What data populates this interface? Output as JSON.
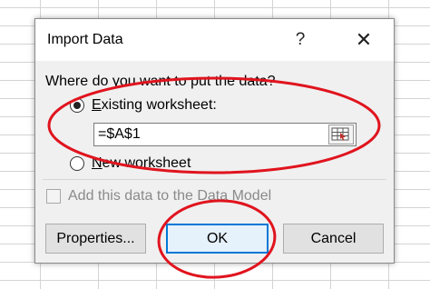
{
  "dialog": {
    "title": "Import Data",
    "help_glyph": "?",
    "close_glyph": "✕",
    "prompt": "Where do you want to put the data?",
    "existing_label": "Existing worksheet:",
    "existing_label_parts": {
      "accel": "E",
      "rest": "xisting worksheet:"
    },
    "new_label_parts": {
      "accel": "N",
      "rest": "ew worksheet"
    },
    "new_label": "New worksheet",
    "reference_value": "=$A$1",
    "data_model_label": "Add this data to the Data Model",
    "buttons": {
      "properties": "Properties...",
      "ok": "OK",
      "cancel": "Cancel"
    },
    "selected_option": "existing_worksheet",
    "data_model_checked": false,
    "data_model_enabled": false
  },
  "annotation_color": "#e0141e",
  "accent_color": "#0078d7"
}
